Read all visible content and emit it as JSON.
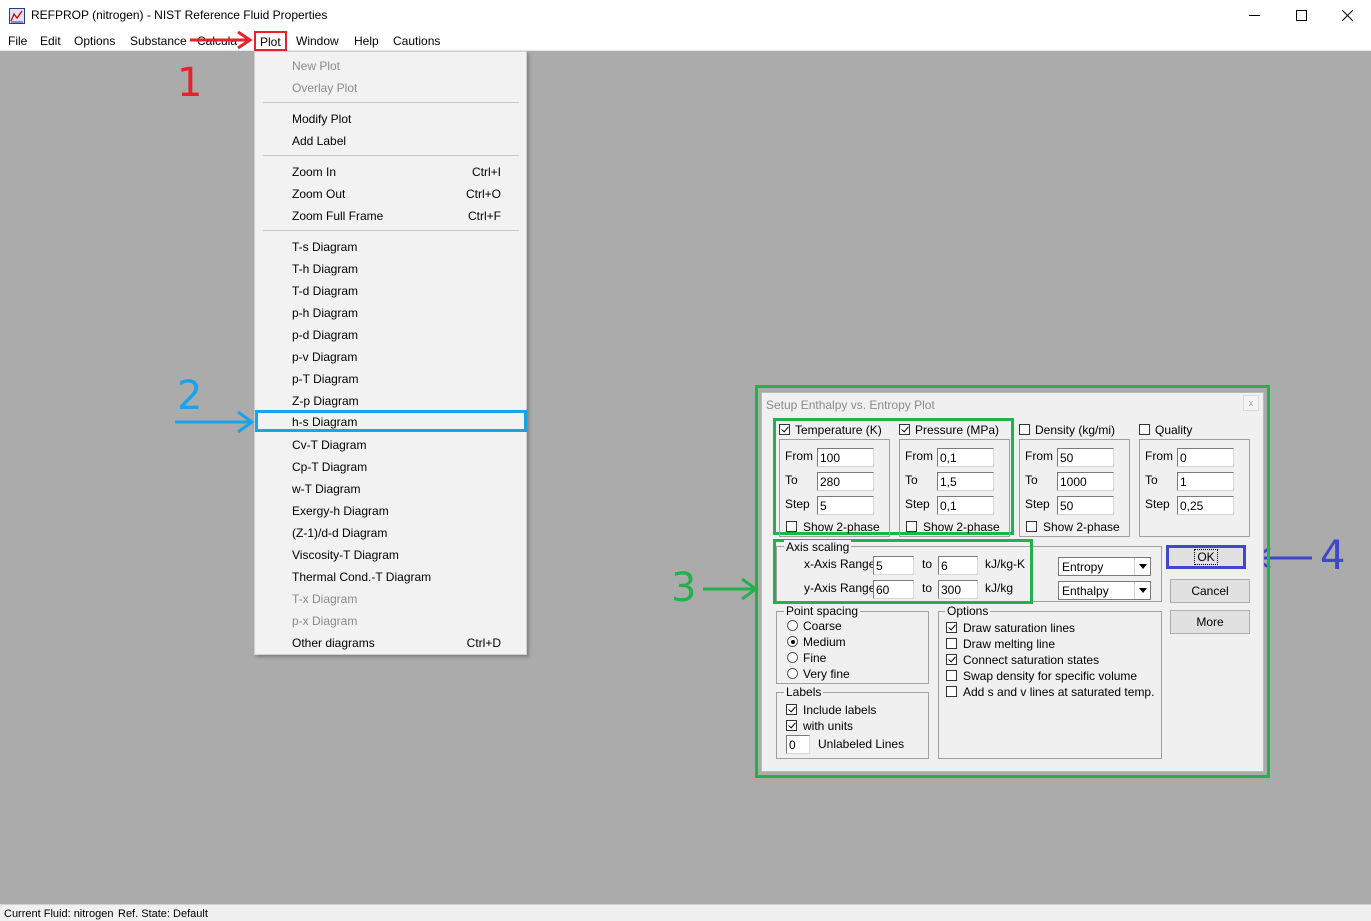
{
  "window": {
    "title": "REFPROP (nitrogen) - NIST Reference Fluid Properties",
    "icon": "refprop-chart-icon"
  },
  "menubar": {
    "items": [
      "File",
      "Edit",
      "Options",
      "Substance",
      "Calcula",
      "Plot",
      "Window",
      "Help",
      "Cautions"
    ]
  },
  "plot_menu": {
    "items": [
      {
        "label": "New Plot",
        "shortcut": "",
        "disabled": true
      },
      {
        "label": "Overlay Plot",
        "shortcut": "",
        "disabled": true
      },
      {
        "label": "Modify Plot",
        "shortcut": ""
      },
      {
        "label": "Add Label",
        "shortcut": ""
      },
      {
        "label": "Zoom In",
        "shortcut": "Ctrl+I"
      },
      {
        "label": "Zoom Out",
        "shortcut": "Ctrl+O"
      },
      {
        "label": "Zoom Full Frame",
        "shortcut": "Ctrl+F"
      },
      {
        "label": "T-s Diagram",
        "shortcut": ""
      },
      {
        "label": "T-h Diagram",
        "shortcut": ""
      },
      {
        "label": "T-d Diagram",
        "shortcut": ""
      },
      {
        "label": "p-h Diagram",
        "shortcut": ""
      },
      {
        "label": "p-d Diagram",
        "shortcut": ""
      },
      {
        "label": "p-v Diagram",
        "shortcut": ""
      },
      {
        "label": "p-T Diagram",
        "shortcut": ""
      },
      {
        "label": "Z-p Diagram",
        "shortcut": ""
      },
      {
        "label": "h-s Diagram",
        "shortcut": "",
        "highlighted": true
      },
      {
        "label": "Cv-T Diagram",
        "shortcut": ""
      },
      {
        "label": "Cp-T Diagram",
        "shortcut": ""
      },
      {
        "label": "w-T Diagram",
        "shortcut": ""
      },
      {
        "label": "Exergy-h Diagram",
        "shortcut": ""
      },
      {
        "label": "(Z-1)/d-d Diagram",
        "shortcut": ""
      },
      {
        "label": "Viscosity-T Diagram",
        "shortcut": ""
      },
      {
        "label": "Thermal Cond.-T Diagram",
        "shortcut": ""
      },
      {
        "label": "T-x Diagram",
        "shortcut": "",
        "disabled": true
      },
      {
        "label": "p-x Diagram",
        "shortcut": "",
        "disabled": true
      },
      {
        "label": "Other diagrams",
        "shortcut": "Ctrl+D"
      }
    ]
  },
  "annotations": {
    "step1": "1",
    "step2": "2",
    "step3": "3",
    "step4": "4",
    "colors": {
      "red": "#e8212a",
      "blue": "#1aa3e8",
      "green": "#22b14c",
      "navy": "#3f48cc"
    }
  },
  "dialog": {
    "title": "Setup Enthalpy vs. Entropy Plot",
    "close_label": "x",
    "columns": [
      {
        "label": "Temperature (K)",
        "checked": true,
        "from": "100",
        "to": "280",
        "step": "5",
        "show2phase": false
      },
      {
        "label": "Pressure (MPa)",
        "checked": true,
        "from": "0,1",
        "to": "1,5",
        "step": "0,1",
        "show2phase": false
      },
      {
        "label": "Density (kg/mi)",
        "checked": false,
        "from": "50",
        "to": "1000",
        "step": "50",
        "show2phase": false
      },
      {
        "label": "Quality",
        "checked": false,
        "from": "0",
        "to": "1",
        "step": "0,25"
      }
    ],
    "field_labels": {
      "from": "From",
      "to": "To",
      "step": "Step",
      "show2phase": "Show 2-phase"
    },
    "axis_scaling": {
      "title": "Axis scaling",
      "x_label": "x-Axis Range",
      "x_from": "5",
      "x_to": "6",
      "x_units": "kJ/kg-K",
      "x_property": "Entropy",
      "y_label": "y-Axis Range",
      "y_from": "60",
      "y_to": "300",
      "y_units": "kJ/kg",
      "y_property": "Enthalpy",
      "to_word": "to"
    },
    "point_spacing": {
      "title": "Point spacing",
      "options": [
        {
          "label": "Coarse",
          "selected": false
        },
        {
          "label": "Medium",
          "selected": true
        },
        {
          "label": "Fine",
          "selected": false
        },
        {
          "label": "Very fine",
          "selected": false
        }
      ]
    },
    "labels": {
      "title": "Labels",
      "include_labels": "Include labels",
      "include_checked": true,
      "with_units": "with units",
      "units_checked": true,
      "unlabeled_value": "0",
      "unlabeled_text": "Unlabeled Lines"
    },
    "options": {
      "title": "Options",
      "items": [
        {
          "label": "Draw saturation lines",
          "checked": true
        },
        {
          "label": "Draw melting line",
          "checked": false
        },
        {
          "label": "Connect saturation states",
          "checked": true
        },
        {
          "label": "Swap density for specific volume",
          "checked": false
        },
        {
          "label": "Add s and v lines at saturated temp.",
          "checked": false
        }
      ]
    },
    "buttons": {
      "ok": "OK",
      "cancel": "Cancel",
      "more": "More"
    }
  },
  "statusbar": {
    "fluid": "Current Fluid: nitrogen",
    "ref_state": "Ref. State: Default"
  }
}
